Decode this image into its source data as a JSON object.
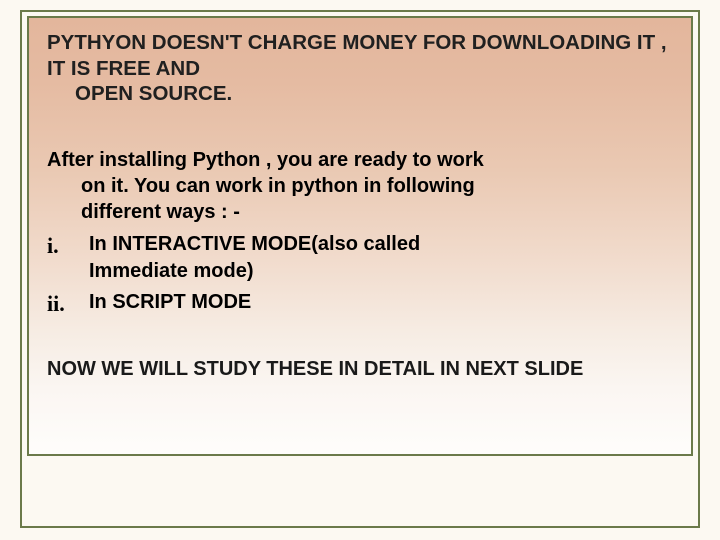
{
  "title": {
    "line1": "PYTHYON DOESN'T CHARGE MONEY FOR DOWNLOADING IT , IT IS FREE AND",
    "line2": "OPEN SOURCE."
  },
  "intro": {
    "line1": "After installing Python , you are ready to work",
    "line2": "on it. You can work in python in following",
    "line3": "different ways : -"
  },
  "list": {
    "item1": {
      "marker": "i.",
      "line1": "In INTERACTIVE MODE(also called",
      "line2": "Immediate mode)"
    },
    "item2": {
      "marker": "ii.",
      "line1": "In SCRIPT MODE"
    }
  },
  "footer": "NOW WE WILL STUDY THESE IN DETAIL IN NEXT SLIDE"
}
